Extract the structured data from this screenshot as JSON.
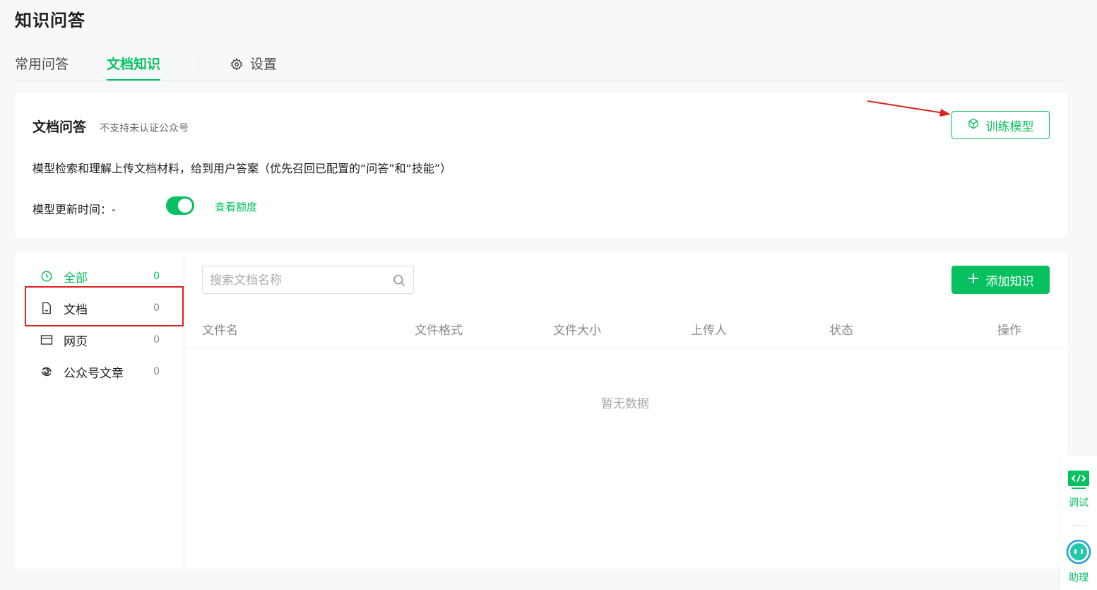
{
  "page": {
    "title": "知识问答"
  },
  "tabs": [
    {
      "label": "常用问答",
      "active": false
    },
    {
      "label": "文档知识",
      "active": true
    },
    {
      "label": "设置",
      "active": false,
      "icon": "gear-icon"
    }
  ],
  "doc_qa": {
    "title": "文档问答",
    "note": "不支持未认证公众号",
    "description": "模型检索和理解上传文档材料，给到用户答案（优先召回已配置的“问答”和“技能”）",
    "update_label": "模型更新时间：-",
    "toggle_on": true,
    "quota_link": "查看额度",
    "train_button": "训练模型",
    "train_icon": "cube-icon"
  },
  "sidebar": {
    "items": [
      {
        "label": "全部",
        "count": "0",
        "icon": "clock-icon",
        "active": true
      },
      {
        "label": "文档",
        "count": "0",
        "icon": "document-icon",
        "active": false
      },
      {
        "label": "网页",
        "count": "0",
        "icon": "webpage-icon",
        "active": false
      },
      {
        "label": "公众号文章",
        "count": "0",
        "icon": "official-account-icon",
        "active": false
      }
    ]
  },
  "search": {
    "placeholder": "搜索文档名称",
    "value": ""
  },
  "add_button": {
    "label": "添加知识",
    "icon": "plus-icon"
  },
  "table": {
    "columns": [
      "文件名",
      "文件格式",
      "文件大小",
      "上传人",
      "状态",
      "操作"
    ],
    "rows": [],
    "empty_text": "暂无数据"
  },
  "float_panel": {
    "debug_label": "调试",
    "debug_icon": "code-icon",
    "assistant_label": "助理",
    "assistant_icon": "robot-icon"
  },
  "colors": {
    "accent": "#07c160",
    "annotation": "#e02020"
  }
}
